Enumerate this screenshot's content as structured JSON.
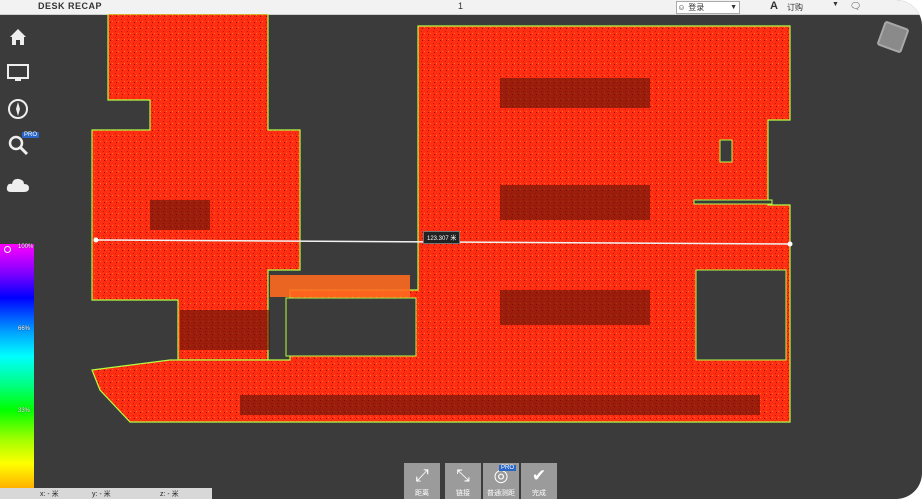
{
  "topbar": {
    "title": "DESK RECAP",
    "page": "1",
    "user": "登录",
    "user_icon": "person-icon",
    "brand": "A",
    "plan": "订购",
    "chat_icon": "chat-icon"
  },
  "sidebar": {
    "items": [
      {
        "name": "home",
        "icon": "⌂"
      },
      {
        "name": "display",
        "icon": "▭"
      },
      {
        "name": "navigate",
        "icon": "✥"
      },
      {
        "name": "search",
        "icon": "⚲"
      },
      {
        "name": "cloud",
        "icon": "☁"
      }
    ],
    "pro_badge": "PRO"
  },
  "legend": {
    "ticks": [
      "100%",
      "66%",
      "33%"
    ]
  },
  "measurement": {
    "value": "123.307 米"
  },
  "status": {
    "x": "x: - 米",
    "y": "y: - 米",
    "z": "z: - 米"
  },
  "toolbar": {
    "tools": [
      {
        "label": "距离",
        "glyph": "⤢"
      },
      {
        "label": "链接",
        "glyph": "⤡"
      },
      {
        "label": "普通测距",
        "glyph": "◎",
        "badge": "PRO"
      },
      {
        "label": "完成",
        "glyph": "✔"
      }
    ]
  },
  "colors": {
    "background": "#3b3b3b",
    "cloud_red": "#ff2a10",
    "cloud_edge": "#b5ff40",
    "accent_blue": "#2a66c8"
  }
}
